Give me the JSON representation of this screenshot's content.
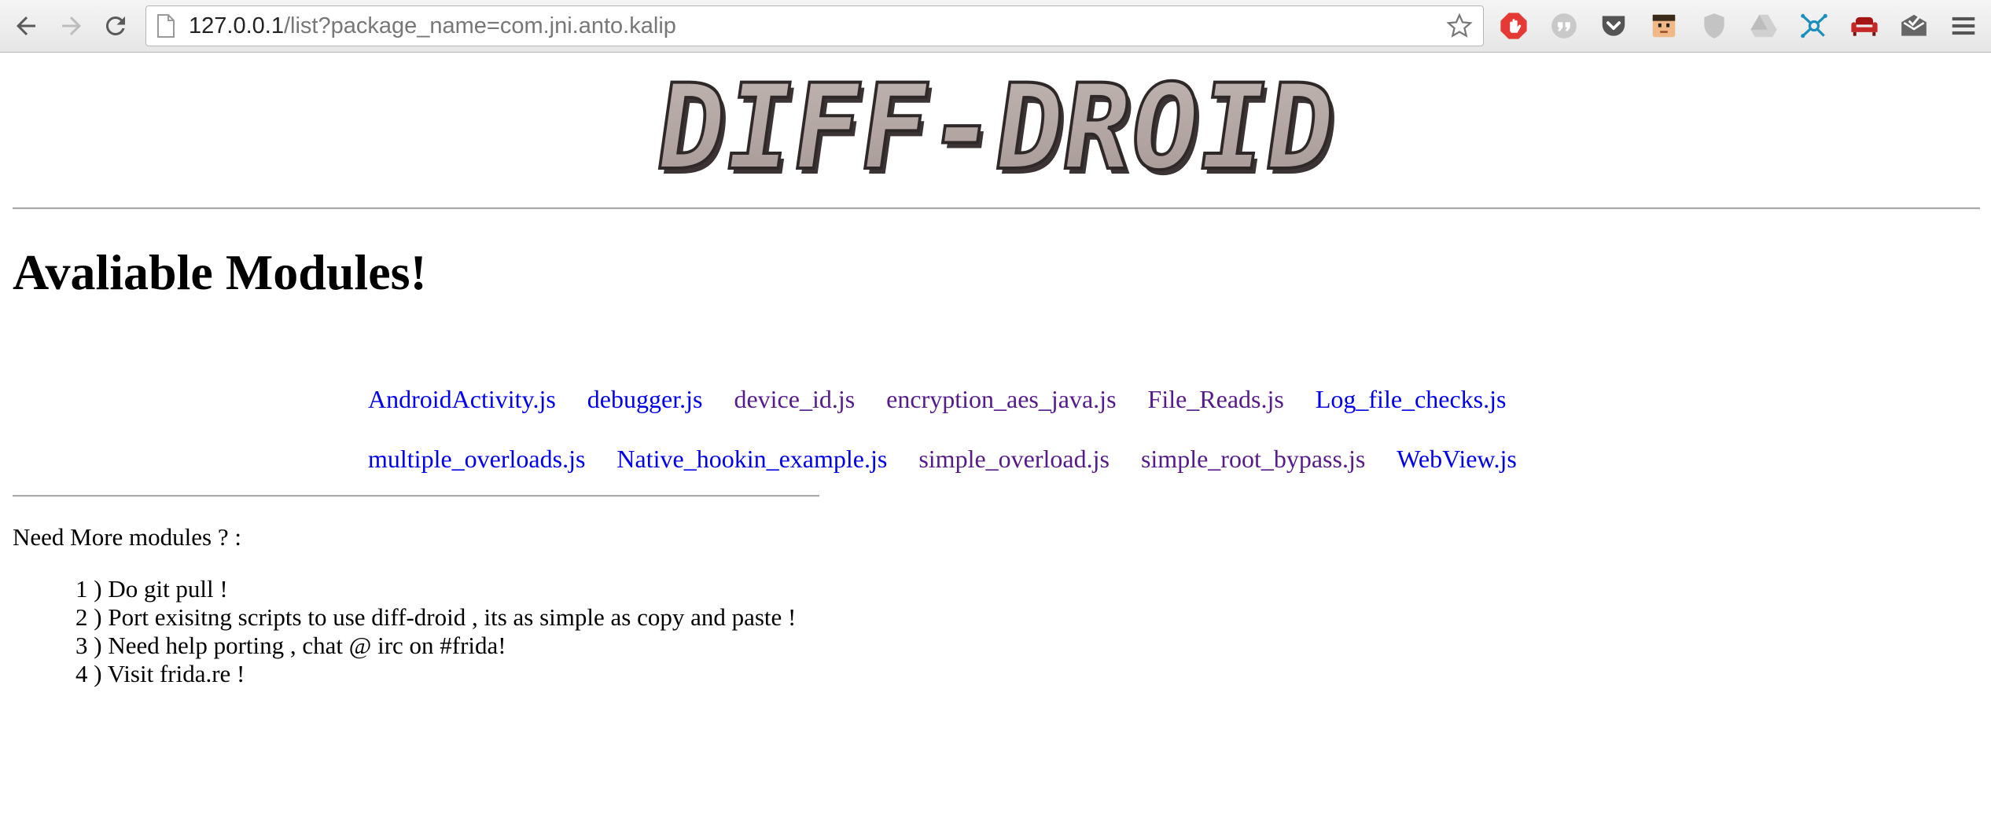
{
  "browser": {
    "url_host": "127.0.0.1",
    "url_rest": "/list?package_name=com.jni.anto.kalip",
    "extensions": [
      "adblock-icon",
      "quote-icon",
      "pocket-icon",
      "face-icon",
      "shield-icon",
      "drive-icon",
      "network-icon",
      "couch-icon",
      "mail-icon"
    ]
  },
  "page": {
    "logo_text": "DIFF-DROID",
    "title": "Avaliable Modules!",
    "module_rows": [
      [
        {
          "label": "AndroidActivity.js",
          "visited": false
        },
        {
          "label": "debugger.js",
          "visited": false
        },
        {
          "label": "device_id.js",
          "visited": true
        },
        {
          "label": "encryption_aes_java.js",
          "visited": true
        },
        {
          "label": "File_Reads.js",
          "visited": true
        },
        {
          "label": "Log_file_checks.js",
          "visited": false
        }
      ],
      [
        {
          "label": "multiple_overloads.js",
          "visited": false
        },
        {
          "label": "Native_hookin_example.js",
          "visited": false
        },
        {
          "label": "simple_overload.js",
          "visited": true
        },
        {
          "label": "simple_root_bypass.js",
          "visited": true
        },
        {
          "label": "WebView.js",
          "visited": false
        }
      ]
    ],
    "need_more": "Need More modules ? :",
    "steps": [
      "1 ) Do git pull !",
      "2 ) Port exisitng scripts to use diff-droid , its as simple as copy and paste !",
      "3 ) Need help porting , chat @ irc on #frida!",
      "4 ) Visit frida.re !"
    ]
  },
  "colors": {
    "link": "#0000ee",
    "link_visited": "#551a8b"
  }
}
